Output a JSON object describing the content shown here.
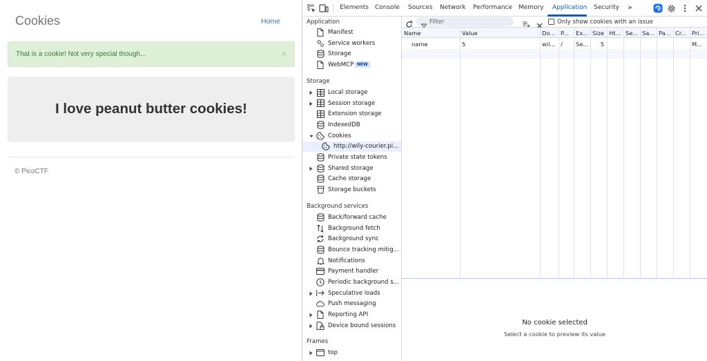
{
  "page": {
    "site_title": "Cookies",
    "home_link": "Home",
    "alert_text": "That is a cookie! Not very special though...",
    "alert_close": "×",
    "jumbotron_text": "I love peanut butter cookies!",
    "footer_text": "© PicoCTF"
  },
  "devtools": {
    "tabs": [
      "Elements",
      "Console",
      "Sources",
      "Network",
      "Performance",
      "Memory",
      "Application",
      "Security"
    ],
    "active_tab": "Application",
    "more_tabs": "»",
    "sections": {
      "application": {
        "title": "Application",
        "items": [
          {
            "label": "Manifest",
            "icon": "file-icon"
          },
          {
            "label": "Service workers",
            "icon": "gears-icon"
          },
          {
            "label": "Storage",
            "icon": "database-icon"
          },
          {
            "label": "WebMCP",
            "icon": "file-icon",
            "badge": "NEW"
          }
        ]
      },
      "storage": {
        "title": "Storage",
        "items": [
          {
            "label": "Local storage",
            "icon": "table-icon",
            "arrow": "collapsed"
          },
          {
            "label": "Session storage",
            "icon": "table-icon",
            "arrow": "collapsed"
          },
          {
            "label": "Extension storage",
            "icon": "table-icon"
          },
          {
            "label": "IndexedDB",
            "icon": "database-icon"
          },
          {
            "label": "Cookies",
            "icon": "cookie-icon",
            "arrow": "expanded"
          },
          {
            "label": "http://wily-courier.pi...",
            "icon": "cookie-icon",
            "selected": true
          },
          {
            "label": "Private state tokens",
            "icon": "database-icon"
          },
          {
            "label": "Shared storage",
            "icon": "database-icon",
            "arrow": "collapsed"
          },
          {
            "label": "Cache storage",
            "icon": "database-icon"
          },
          {
            "label": "Storage buckets",
            "icon": "bucket-icon"
          }
        ]
      },
      "background": {
        "title": "Background services",
        "items": [
          {
            "label": "Back/forward cache",
            "icon": "database-icon"
          },
          {
            "label": "Background fetch",
            "icon": "updown-arrows-icon"
          },
          {
            "label": "Background sync",
            "icon": "sync-icon"
          },
          {
            "label": "Bounce tracking mitig...",
            "icon": "database-icon"
          },
          {
            "label": "Notifications",
            "icon": "bell-icon"
          },
          {
            "label": "Payment handler",
            "icon": "card-icon"
          },
          {
            "label": "Periodic background s...",
            "icon": "clock-icon"
          },
          {
            "label": "Speculative loads",
            "icon": "arrow-right-bar-icon",
            "arrow": "collapsed"
          },
          {
            "label": "Push messaging",
            "icon": "cloud-icon"
          },
          {
            "label": "Reporting API",
            "icon": "file-icon",
            "arrow": "collapsed"
          },
          {
            "label": "Device bound sessions",
            "icon": "lock-file-icon",
            "arrow": "collapsed"
          }
        ]
      },
      "frames": {
        "title": "Frames",
        "items": [
          {
            "label": "top",
            "icon": "frame-icon",
            "arrow": "collapsed"
          }
        ]
      }
    },
    "toolbar": {
      "filter_placeholder": "Filter",
      "only_issue_label": "Only show cookies with an issue"
    },
    "table": {
      "headers": [
        "Name",
        "Value",
        "Do...",
        "P...",
        "Ex...",
        "Size",
        "Ht...",
        "Se...",
        "Sa...",
        "Pa...",
        "Cr...",
        "Pri..."
      ],
      "rows": [
        [
          "name",
          "5",
          "wil...",
          "/",
          "Se...",
          "5",
          "",
          "",
          "",
          "",
          "",
          "M..."
        ]
      ]
    },
    "preview": {
      "title": "No cookie selected",
      "subtitle": "Select a cookie to preview its value"
    }
  }
}
